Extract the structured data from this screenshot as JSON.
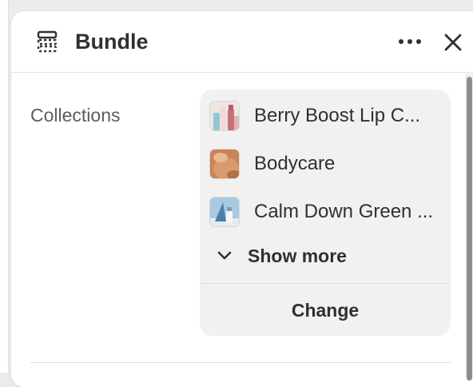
{
  "panel": {
    "title": "Bundle",
    "header_icon": "bundle-icon",
    "more_icon": "more-horizontal-icon",
    "close_icon": "close-icon"
  },
  "collections": {
    "label": "Collections",
    "items": [
      {
        "label": "Berry Boost Lip C...",
        "thumbnail": "lip-products-thumbnail"
      },
      {
        "label": "Bodycare",
        "thumbnail": "skin-thumbnail"
      },
      {
        "label": "Calm Down Green ...",
        "thumbnail": "green-product-thumbnail"
      }
    ],
    "show_more_label": "Show more",
    "show_more_icon": "chevron-down-icon",
    "change_label": "Change"
  },
  "colors": {
    "panel_background": "#ffffff",
    "card_background": "#f1f1f1",
    "text_primary": "#303030",
    "text_secondary": "#5c5c5c",
    "scroll_thumb": "#8d8d8d"
  }
}
